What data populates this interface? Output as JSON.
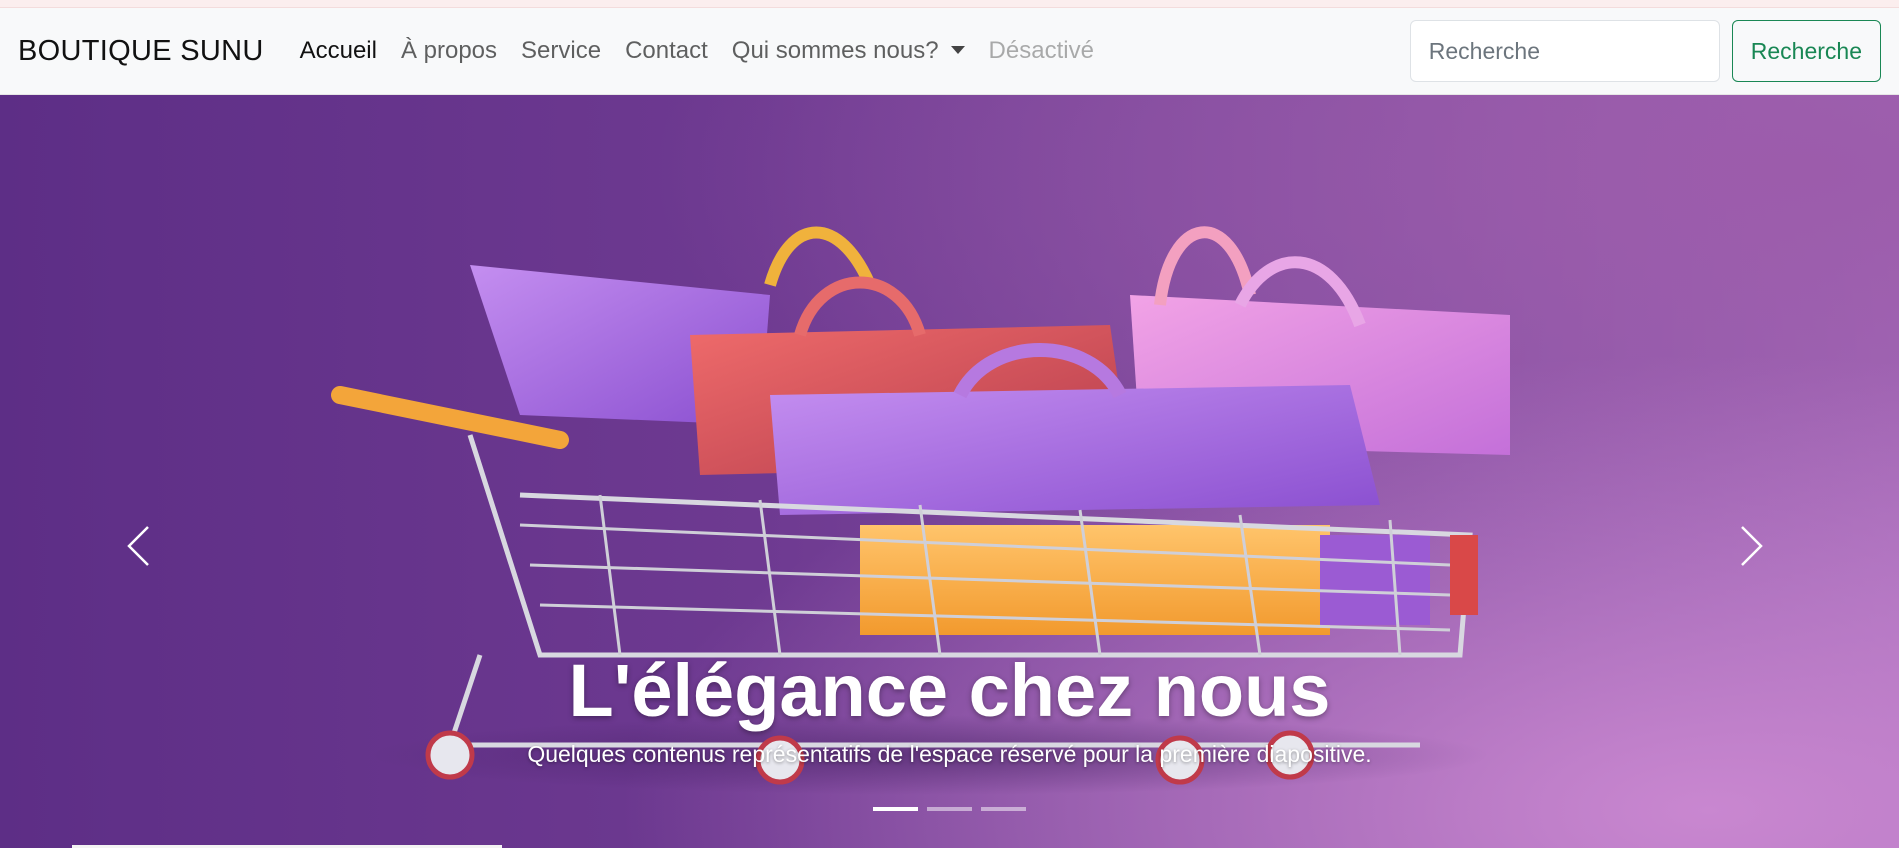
{
  "navbar": {
    "brand": "BOUTIQUE SUNU",
    "items": [
      {
        "label": "Accueil",
        "state": "active"
      },
      {
        "label": "À propos",
        "state": "normal"
      },
      {
        "label": "Service",
        "state": "normal"
      },
      {
        "label": "Contact",
        "state": "normal"
      },
      {
        "label": "Qui sommes nous?",
        "state": "dropdown"
      },
      {
        "label": "Désactivé",
        "state": "disabled"
      }
    ],
    "search": {
      "placeholder": "Recherche",
      "button_label": "Recherche"
    }
  },
  "carousel": {
    "slide": {
      "title": "L'élégance chez nous",
      "text": "Quelques contenus représentatifs de l'espace réservé pour la première diapositive."
    },
    "indicators_count": 3,
    "active_index": 0,
    "prev_icon": "chevron-left-icon",
    "next_icon": "chevron-right-icon"
  },
  "colors": {
    "accent_green": "#198754",
    "hero_purple": "#6e3a91"
  }
}
